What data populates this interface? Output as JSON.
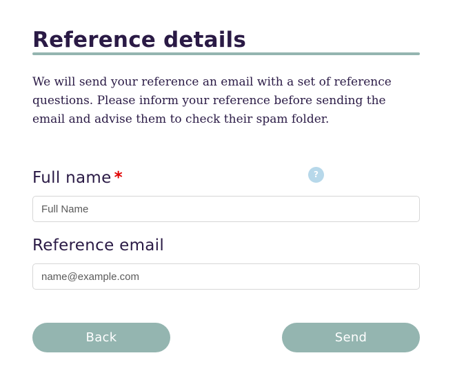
{
  "header": {
    "title": "Reference details",
    "intro": "We will send your reference an email with a set of reference questions. Please inform your reference before sending the email and advise them to check their spam folder."
  },
  "form": {
    "full_name": {
      "label": "Full name",
      "required_marker": "*",
      "placeholder": "Full Name",
      "value": "",
      "help_icon": "?"
    },
    "reference_email": {
      "label": "Reference email",
      "placeholder": "name@example.com",
      "value": ""
    }
  },
  "actions": {
    "back_label": "Back",
    "send_label": "Send"
  },
  "colors": {
    "title_text": "#2a1a45",
    "accent": "#94b5b0",
    "required": "#e00000",
    "help_icon_bg": "#b7d8ea"
  },
  "icons": {
    "help": "question-mark-circle-icon"
  }
}
